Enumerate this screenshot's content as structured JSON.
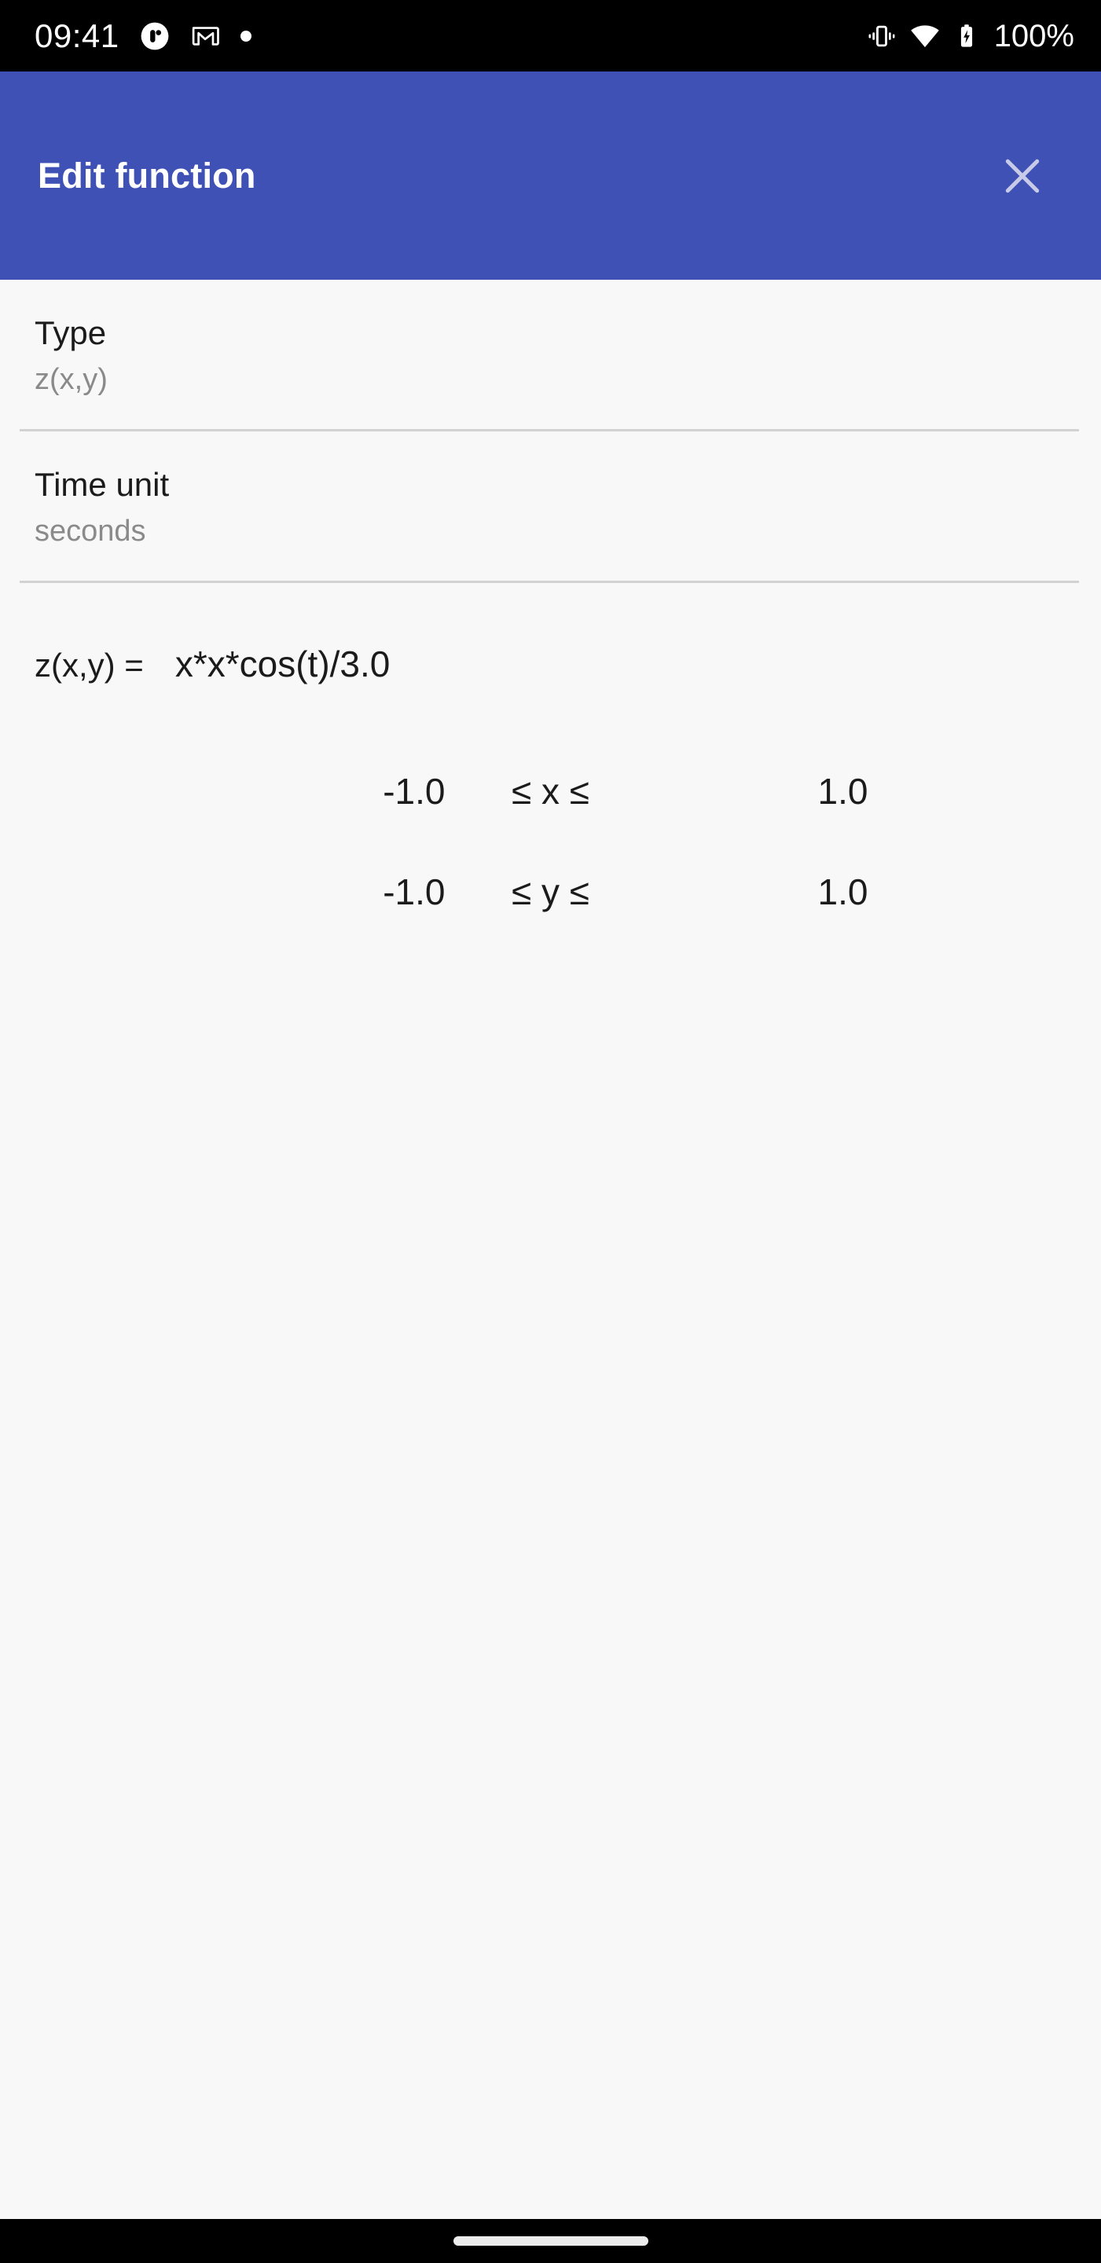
{
  "status_bar": {
    "time": "09:41",
    "battery_percent": "100%",
    "left_icons": [
      "app-notification-icon",
      "gmail-icon",
      "dot-icon"
    ],
    "right_icons": [
      "vibrate-icon",
      "wifi-icon",
      "battery-charging-icon"
    ]
  },
  "app_bar": {
    "title": "Edit function",
    "close_icon": "close-icon",
    "background_color": "#3F51B5",
    "title_color": "#FFFFFF"
  },
  "preferences": [
    {
      "title": "Type",
      "value": "z(x,y)"
    },
    {
      "title": "Time unit",
      "value": "seconds"
    }
  ],
  "formula": {
    "label": "z(x,y) =",
    "value": "x*x*cos(t)/3.0"
  },
  "ranges": [
    {
      "min": "-1.0",
      "operator": "≤ x ≤",
      "max": "1.0"
    },
    {
      "min": "-1.0",
      "operator": "≤ y ≤",
      "max": "1.0"
    }
  ],
  "nav_bar": {
    "gesture_pill": "home-gesture-pill"
  },
  "theme": {
    "background": "#F8F8F8",
    "accent": "#3F51B5",
    "text_primary": "#1B1B1B",
    "text_secondary": "#8A8A8A",
    "divider": "#D2D2D2",
    "underline": "#6E6E6E"
  }
}
